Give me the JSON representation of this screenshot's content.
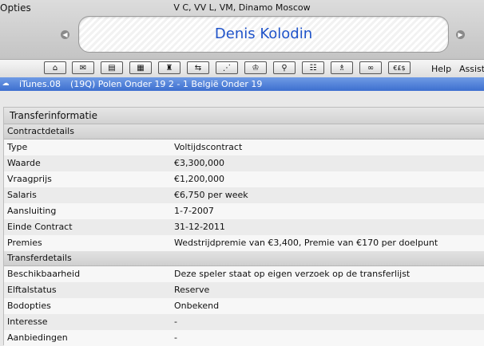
{
  "menu": {
    "opties": "Opties",
    "help": "Help",
    "assist": "Assist"
  },
  "header": {
    "subtitle": "V C, VV L, VM, Dinamo Moscow",
    "player_name": "Denis Kolodin"
  },
  "toolbar": {
    "buttons": [
      {
        "icon": "home-icon",
        "glyph": "⌂"
      },
      {
        "icon": "mail-icon",
        "glyph": "✉"
      },
      {
        "icon": "card-icon",
        "glyph": "▤"
      },
      {
        "icon": "calendar-icon",
        "glyph": "▦"
      },
      {
        "icon": "squad-icon",
        "glyph": "♜"
      },
      {
        "icon": "transfer-arrows-icon",
        "glyph": "⇆"
      },
      {
        "icon": "tactics-icon",
        "glyph": "⋰"
      },
      {
        "icon": "trophy-icon",
        "glyph": "♔"
      },
      {
        "icon": "search-icon",
        "glyph": "⚲"
      },
      {
        "icon": "clipboard-icon",
        "glyph": "☷"
      },
      {
        "icon": "staff-icon",
        "glyph": "♗"
      },
      {
        "icon": "scout-binoculars-icon",
        "glyph": "∞"
      },
      {
        "icon": "finance-icon",
        "glyph": "€£$"
      }
    ]
  },
  "status": {
    "app": "iTunes.08",
    "match": "(19Q) Polen Onder 19 2 - 1 België Onder 19"
  },
  "panel": {
    "title": "Transferinformatie",
    "contract_header": "Contractdetails",
    "contract_rows": [
      {
        "label": "Type",
        "value": "Voltijdscontract"
      },
      {
        "label": "Waarde",
        "value": "€3,300,000"
      },
      {
        "label": "Vraagprijs",
        "value": "€1,200,000"
      },
      {
        "label": "Salaris",
        "value": "€6,750 per week"
      },
      {
        "label": "Aansluiting",
        "value": "1-7-2007"
      },
      {
        "label": "Einde Contract",
        "value": "31-12-2011"
      },
      {
        "label": "Premies",
        "value": "Wedstrijdpremie van €3,400, Premie van €170 per doelpunt"
      }
    ],
    "transfer_header": "Transferdetails",
    "transfer_rows": [
      {
        "label": "Beschikbaarheid",
        "value": "Deze speler staat op eigen verzoek op de transferlijst"
      },
      {
        "label": "Elftalstatus",
        "value": "Reserve"
      },
      {
        "label": "Bodopties",
        "value": "Onbekend"
      },
      {
        "label": "Interesse",
        "value": "-"
      },
      {
        "label": "Aanbiedingen",
        "value": "-"
      }
    ]
  }
}
